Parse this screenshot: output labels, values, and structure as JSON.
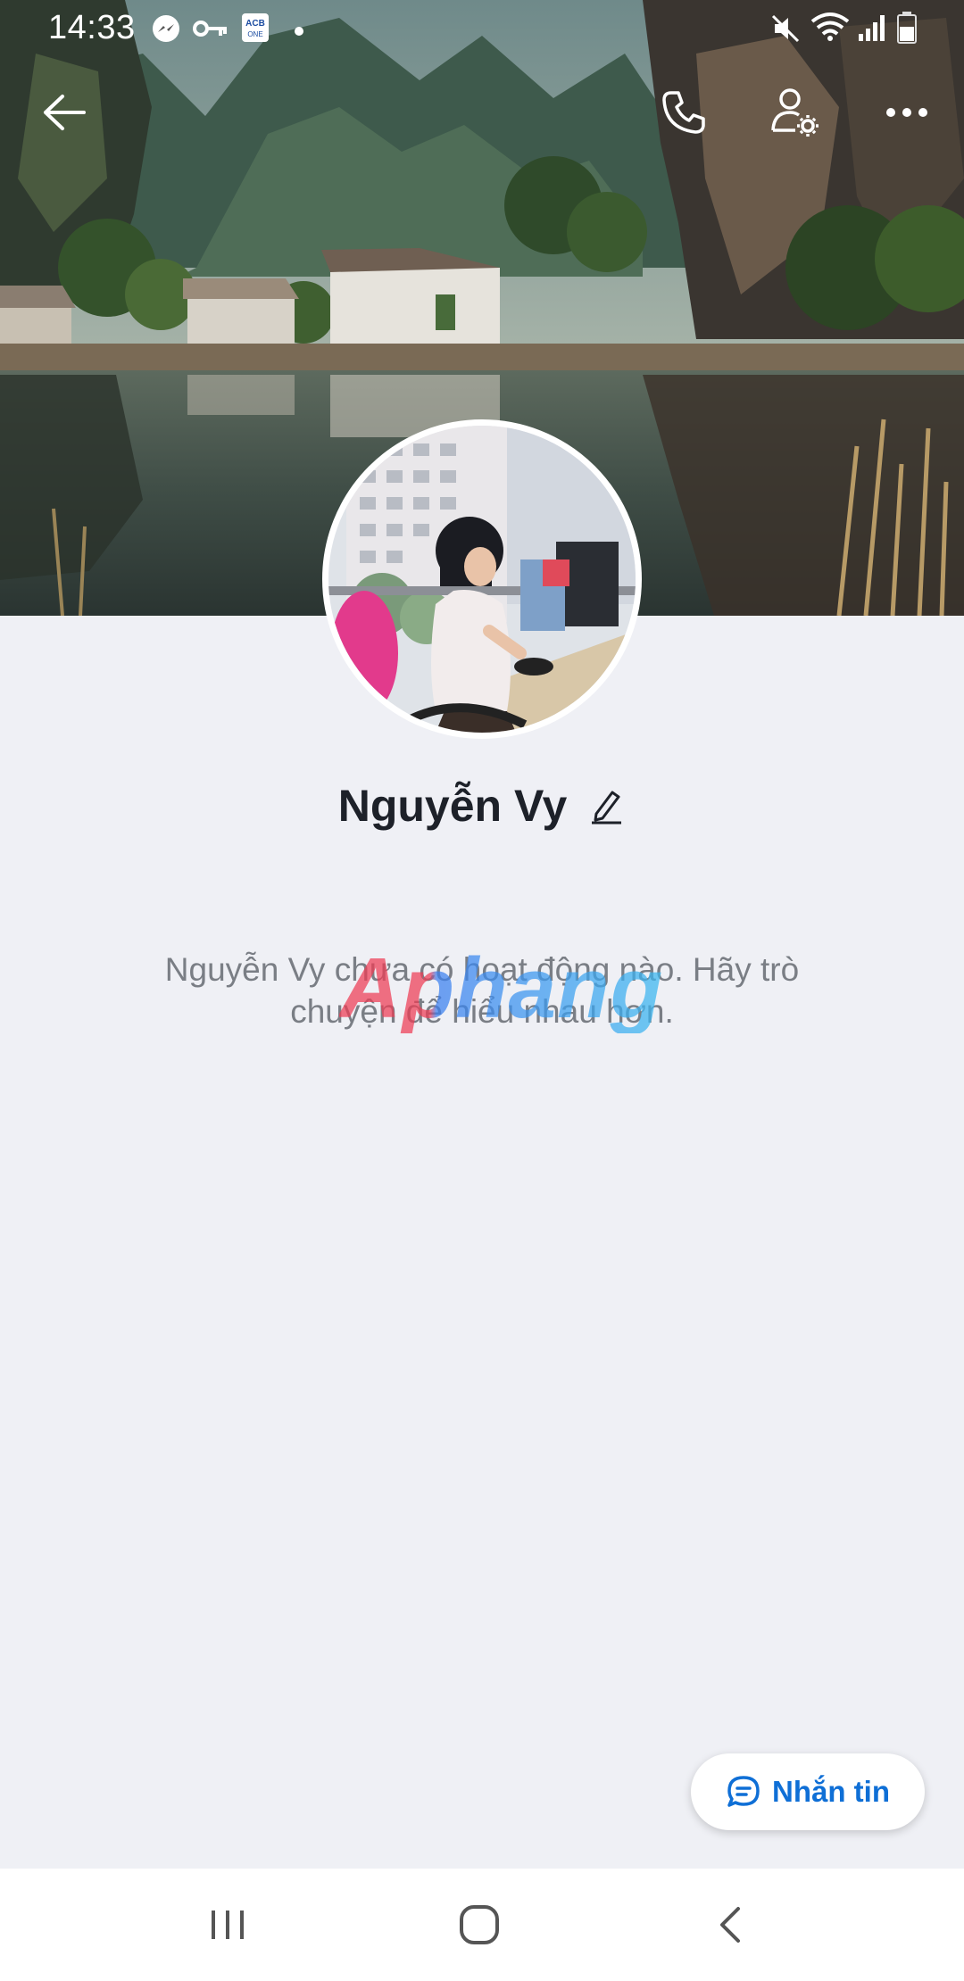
{
  "status_bar": {
    "time": "14:33",
    "icons": [
      "messenger-icon",
      "key-icon",
      "acb-one-icon",
      "dot-icon",
      "mute-icon",
      "wifi-icon",
      "signal-icon",
      "battery-icon"
    ],
    "acb_label": "ACB ONE"
  },
  "app_bar": {
    "back_icon": "arrow-left-icon",
    "call_icon": "phone-icon",
    "settings_icon": "user-settings-icon",
    "more_icon": "more-horizontal-icon"
  },
  "profile": {
    "name": "Nguyễn Vy",
    "edit_icon": "pencil-icon"
  },
  "empty_state": {
    "line1": "Nguyễn Vy chưa có hoạt động nào. Hãy trò",
    "line2": "chuyện để hiểu nhau hơn."
  },
  "watermark": "Aphang",
  "message_button": {
    "label": "Nhắn tin",
    "icon": "chat-bubble-icon",
    "color": "#0f6fd6"
  },
  "nav_bar": {
    "recents_icon": "recents-icon",
    "home_icon": "home-icon",
    "back_icon": "nav-back-icon"
  },
  "colors": {
    "page_background": "#eff0f5",
    "name_text": "#1d2129",
    "muted_text": "#7a7e85"
  }
}
